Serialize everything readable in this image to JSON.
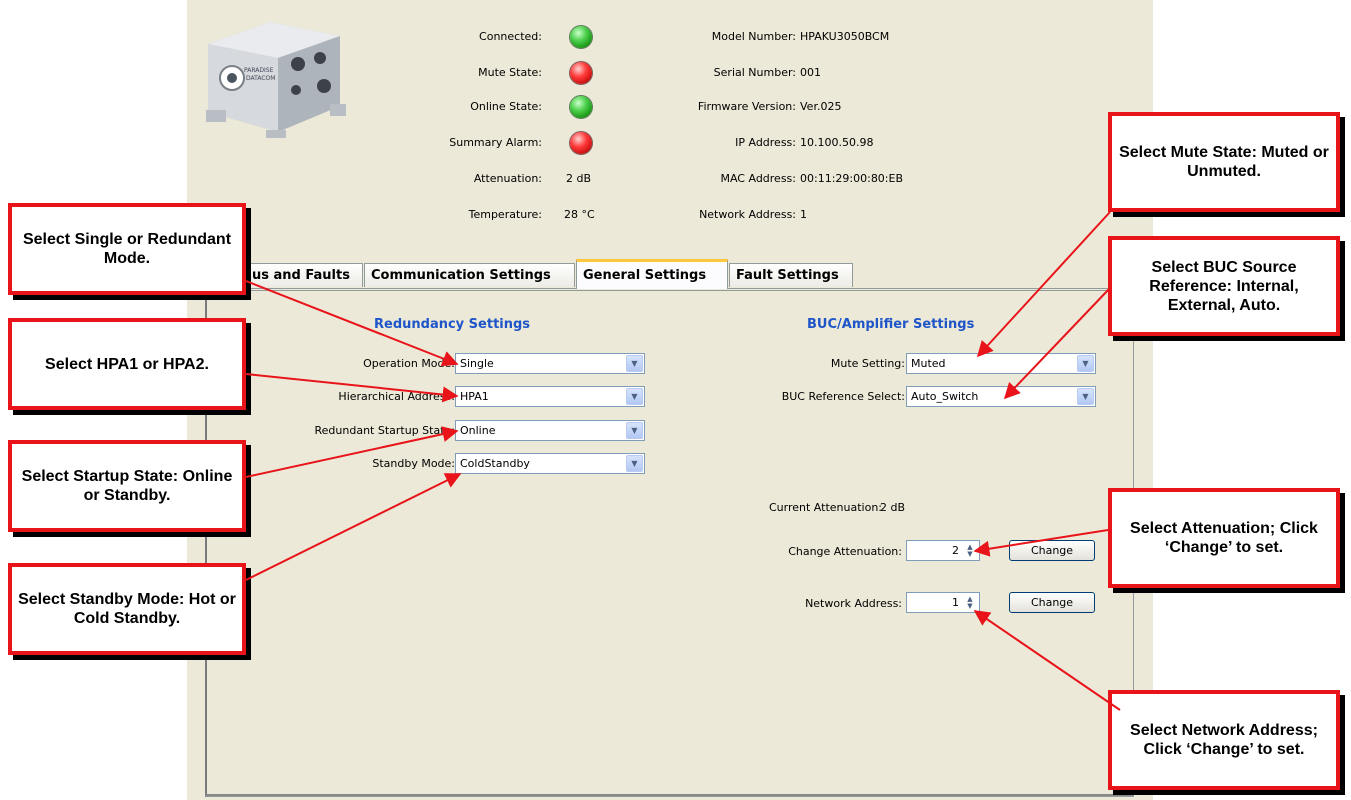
{
  "status": {
    "labels": {
      "connected": "Connected:",
      "mute_state": "Mute State:",
      "online_state": "Online State:",
      "summary_alarm": "Summary Alarm:",
      "attenuation": "Attenuation:",
      "temperature": "Temperature:"
    },
    "values": {
      "attenuation": "2 dB",
      "temperature": "28 °C"
    },
    "indicator_colors": {
      "connected": "green",
      "mute_state": "red",
      "online_state": "green",
      "summary_alarm": "red"
    }
  },
  "info": {
    "model_label": "Model Number:",
    "model_value": "HPAKU3050BCM",
    "serial_label": "Serial Number:",
    "serial_value": "001",
    "firmware_label": "Firmware Version:",
    "firmware_value": "Ver.025",
    "ip_label": "IP Address:",
    "ip_value": "10.100.50.98",
    "mac_label": "MAC Address:",
    "mac_value": "00:11:29:00:80:EB",
    "network_label": "Network Address:",
    "network_value": "1"
  },
  "device_logo": "PARADISE DATACOM",
  "tabs": [
    {
      "label": "us and Faults"
    },
    {
      "label": "Communication Settings"
    },
    {
      "label": "General Settings",
      "active": true
    },
    {
      "label": "Fault Settings"
    }
  ],
  "redundancy": {
    "title": "Redundancy Settings",
    "operation_mode_label": "Operation Mode:",
    "operation_mode_value": "Single",
    "hierarchical_label": "Hierarchical Address:",
    "hierarchical_value": "HPA1",
    "startup_label": "Redundant Startup State:",
    "startup_value": "Online",
    "standby_label": "Standby Mode:",
    "standby_value": "ColdStandby"
  },
  "buc": {
    "title": "BUC/Amplifier Settings",
    "mute_label": "Mute Setting:",
    "mute_value": "Muted",
    "ref_label": "BUC Reference Select:",
    "ref_value": "Auto_Switch",
    "current_att_label": "Current Attenuation:",
    "current_att_value": "2 dB",
    "change_att_label": "Change Attenuation:",
    "change_att_value": "2",
    "net_addr_label": "Network Address:",
    "net_addr_value": "1",
    "change_button": "Change"
  },
  "callouts": {
    "single_redundant": "Select Single or Redundant Mode.",
    "hpa": "Select HPA1 or HPA2.",
    "startup": "Select Startup State: Online or Standby.",
    "standby": "Select Standby Mode: Hot or Cold Standby.",
    "mute": "Select Mute State: Muted or Unmuted.",
    "buc_ref": "Select BUC Source Reference: Internal, External, Auto.",
    "attenuation": "Select Attenuation; Click ‘Change’ to set.",
    "network": "Select Network Address; Click ‘Change’ to set."
  },
  "colors": {
    "callout_border": "#e8141a",
    "arrow": "#e8141a",
    "section_title": "#1e55c8",
    "tab_highlight": "#ffc83c"
  }
}
